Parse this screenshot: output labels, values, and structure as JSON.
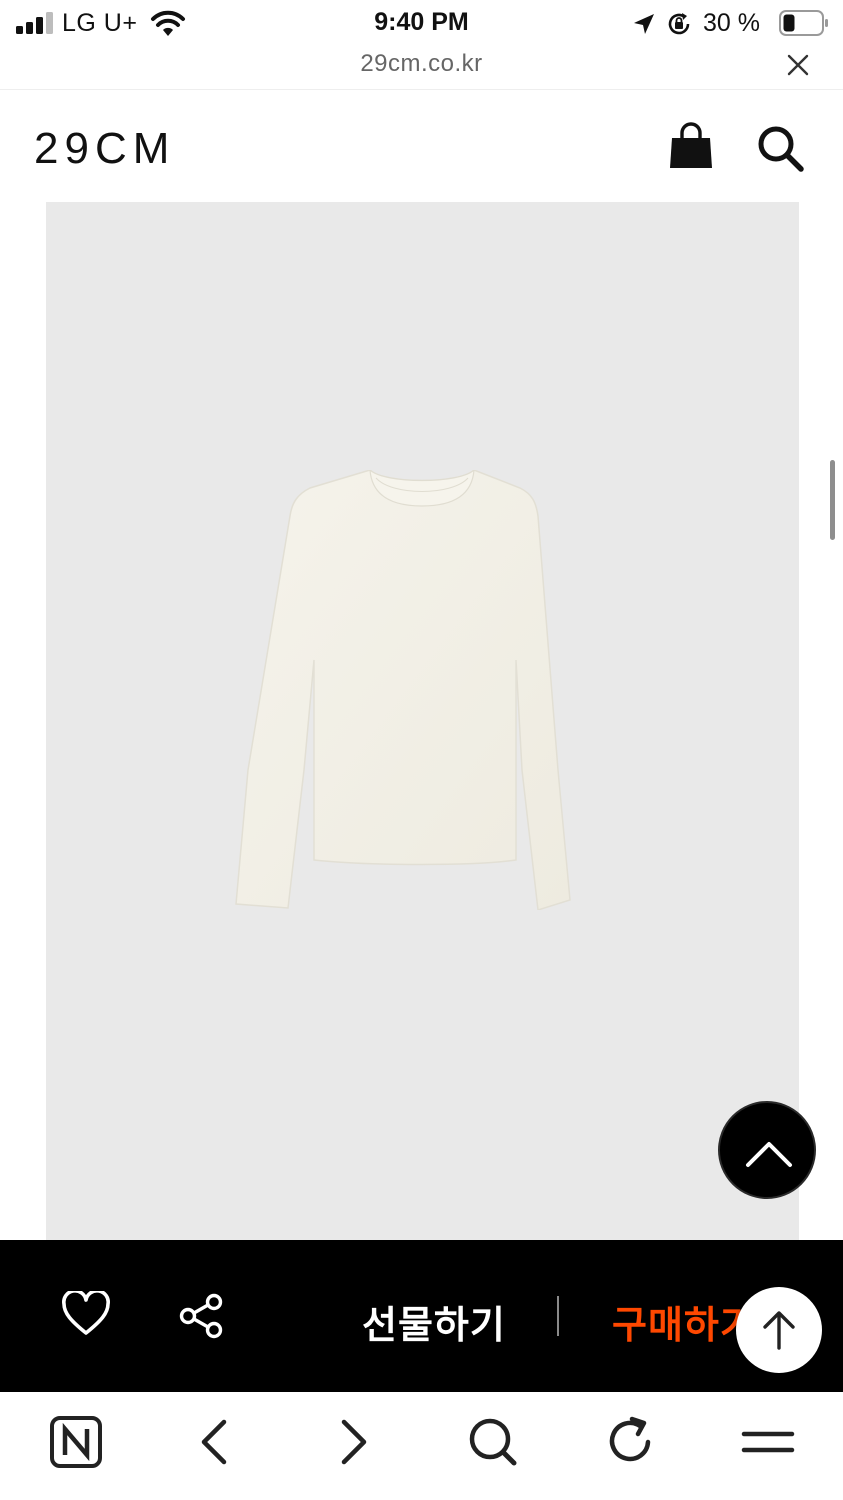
{
  "status_bar": {
    "carrier": "LG U+",
    "time": "9:40 PM",
    "battery_percent": "30 %",
    "battery_level": 0.3,
    "signal_bars": 3,
    "icons": [
      "signal-icon",
      "wifi-icon",
      "location-arrow-icon",
      "rotation-lock-icon",
      "battery-icon"
    ]
  },
  "browser": {
    "url": "29cm.co.kr",
    "close_icon": "close-icon"
  },
  "header": {
    "logo": "29CM",
    "icons": [
      "shopping-bag-icon",
      "search-icon"
    ]
  },
  "product": {
    "image_alt_icon": "long-sleeve-tshirt-image",
    "background_color": "#e9e9e9",
    "garment_color": "#f3f1e8"
  },
  "purchase_bar": {
    "gift_label": "선물하기",
    "buy_label": "구매하기",
    "buy_color": "#ff4800",
    "icons": [
      "heart-icon",
      "share-icon"
    ]
  },
  "floating": {
    "scroll_top_icon": "chevron-up-icon",
    "up_arrow_icon": "arrow-up-icon"
  },
  "toolbar": {
    "icons": [
      "naver-home-icon",
      "back-icon",
      "forward-icon",
      "search-icon",
      "refresh-icon",
      "menu-icon"
    ]
  }
}
